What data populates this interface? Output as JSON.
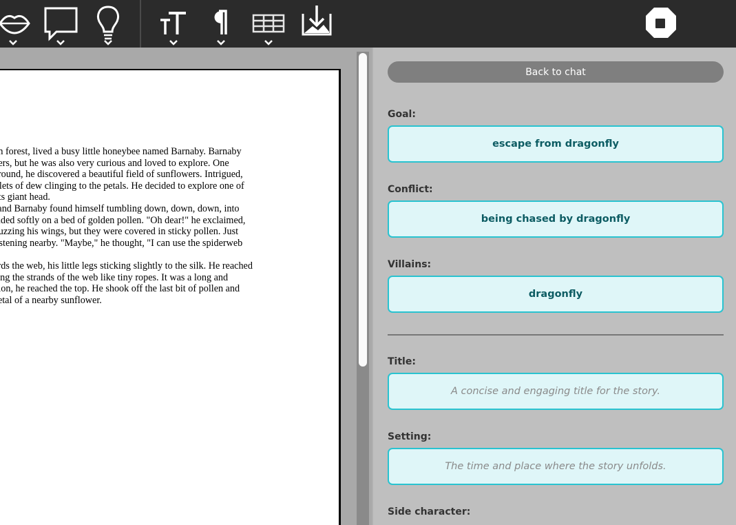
{
  "toolbar": {
    "icons": [
      "lips-icon",
      "chat-bubble-icon",
      "lightbulb-icon",
      "text-size-icon",
      "pilcrow-icon",
      "table-icon",
      "download-image-icon",
      "stop-icon"
    ]
  },
  "document": {
    "lines": [
      "reen forest, lived a busy little honeybee named Barnaby. Barnaby",
      "owers, but he was also very curious and loved to explore. One",
      "g around, he discovered a beautiful field of sunflowers. Intrigued,",
      "roplets of dew clinging to the petals. He decided to explore one of",
      "le its giant head.",
      "w, and Barnaby found himself tumbling down, down, down, into",
      " landed softly on a bed of golden pollen. \"Oh dear!\" he exclaimed,",
      "d buzzing his wings, but they were covered in sticky pollen. Just",
      " glistening nearby. \"Maybe,\" he thought, \"I can use the spiderweb",
      "",
      "wards the web, his little legs sticking slightly to the silk. He reached",
      " using the strands of the web like tiny ropes. It was a long and",
      "nation, he reached the top. He shook off the last bit of pollen and",
      "e petal of a nearby sunflower."
    ]
  },
  "panel": {
    "back_label": "Back to chat",
    "goal_label": "Goal:",
    "goal_value": "escape from dragonfly",
    "conflict_label": "Conflict:",
    "conflict_value": "being chased by dragonfly",
    "villains_label": "Villains:",
    "villains_value": "dragonfly",
    "title_label": "Title:",
    "title_placeholder": "A concise and engaging title for the story.",
    "setting_label": "Setting:",
    "setting_placeholder": "The time and place where the story unfolds.",
    "side_label": "Side character:"
  },
  "colors": {
    "toolbar_bg": "#2b2b2b",
    "accent": "#29c3d0",
    "field_bg": "#dff6f8",
    "field_text": "#0d5c63"
  }
}
